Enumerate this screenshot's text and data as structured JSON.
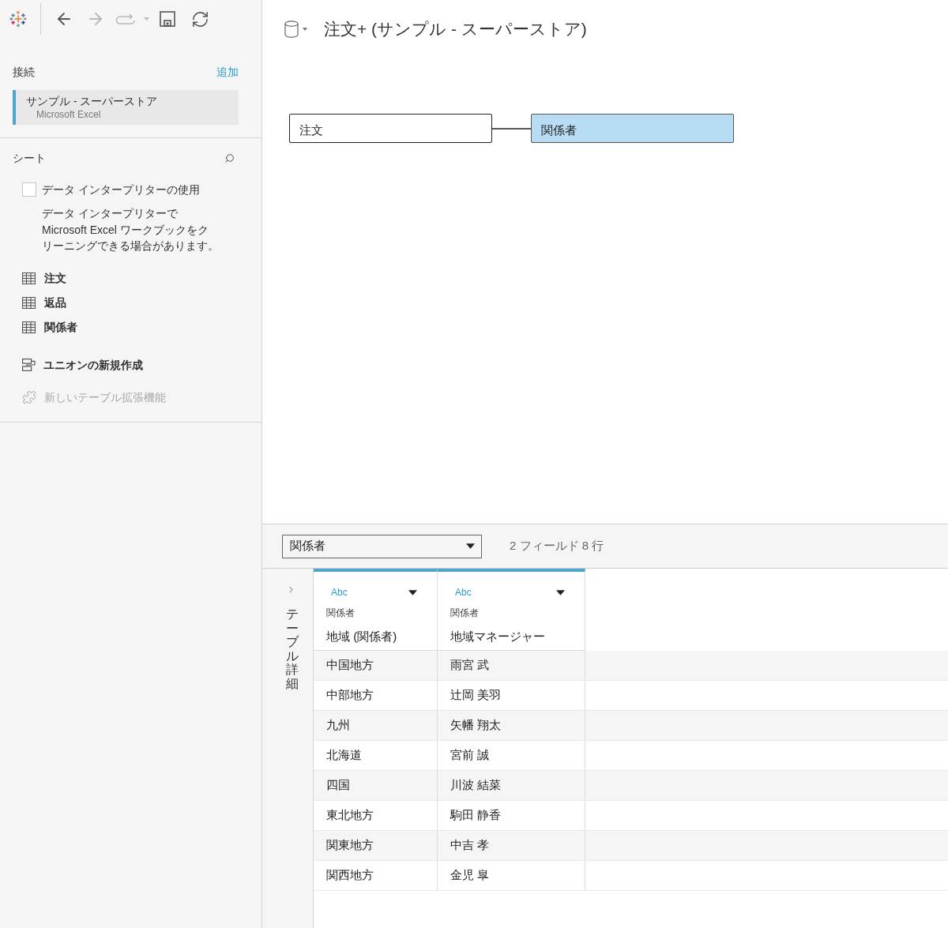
{
  "toolbar": [
    {
      "kind": "back",
      "disabled": false
    },
    {
      "kind": "forward",
      "disabled": true
    },
    {
      "kind": "replay",
      "disabled": true
    },
    {
      "kind": "save",
      "disabled": false
    },
    {
      "kind": "refresh",
      "disabled": false
    }
  ],
  "connections": {
    "title": "接続",
    "add_label": "追加",
    "items": [
      {
        "name": "サンプル - スーパーストア",
        "type": "Microsoft Excel",
        "selected": true
      }
    ]
  },
  "sheets": {
    "title": "シート",
    "interpreter": {
      "label": "データ インタープリターの使用",
      "checked": false,
      "description": "データ インタープリターで Microsoft Excel ワークブックをクリーニングできる場合があります。"
    },
    "items": [
      {
        "name": "注文"
      },
      {
        "name": "返品"
      },
      {
        "name": "関係者"
      }
    ],
    "actions": [
      {
        "kind": "union",
        "label": "ユニオンの新規作成",
        "disabled": false
      },
      {
        "kind": "extension",
        "label": "新しいテーブル拡張機能",
        "disabled": true
      }
    ]
  },
  "data_source": {
    "title": "注文+ (サンプル - スーパーストア)"
  },
  "canvas": {
    "tables": [
      {
        "name": "注文",
        "selected": false
      },
      {
        "name": "関係者",
        "selected": true
      }
    ]
  },
  "preview": {
    "table_select": {
      "value": "関係者"
    },
    "summary": "2 フィールド 8 行",
    "details_panel": {
      "label": "テーブル詳細",
      "expanded": false
    },
    "columns": [
      {
        "type": "Abc",
        "table": "関係者",
        "name": "地域 (関係者)"
      },
      {
        "type": "Abc",
        "table": "関係者",
        "name": "地域マネージャー"
      }
    ],
    "rows": [
      [
        "中国地方",
        "雨宮 武"
      ],
      [
        "中部地方",
        "辻岡 美羽"
      ],
      [
        "九州",
        "矢幡 翔太"
      ],
      [
        "北海道",
        "宮前 誠"
      ],
      [
        "四国",
        "川波 結菜"
      ],
      [
        "東北地方",
        "駒田 静香"
      ],
      [
        "関東地方",
        "中吉 孝"
      ],
      [
        "関西地方",
        "金児 皐"
      ]
    ]
  }
}
